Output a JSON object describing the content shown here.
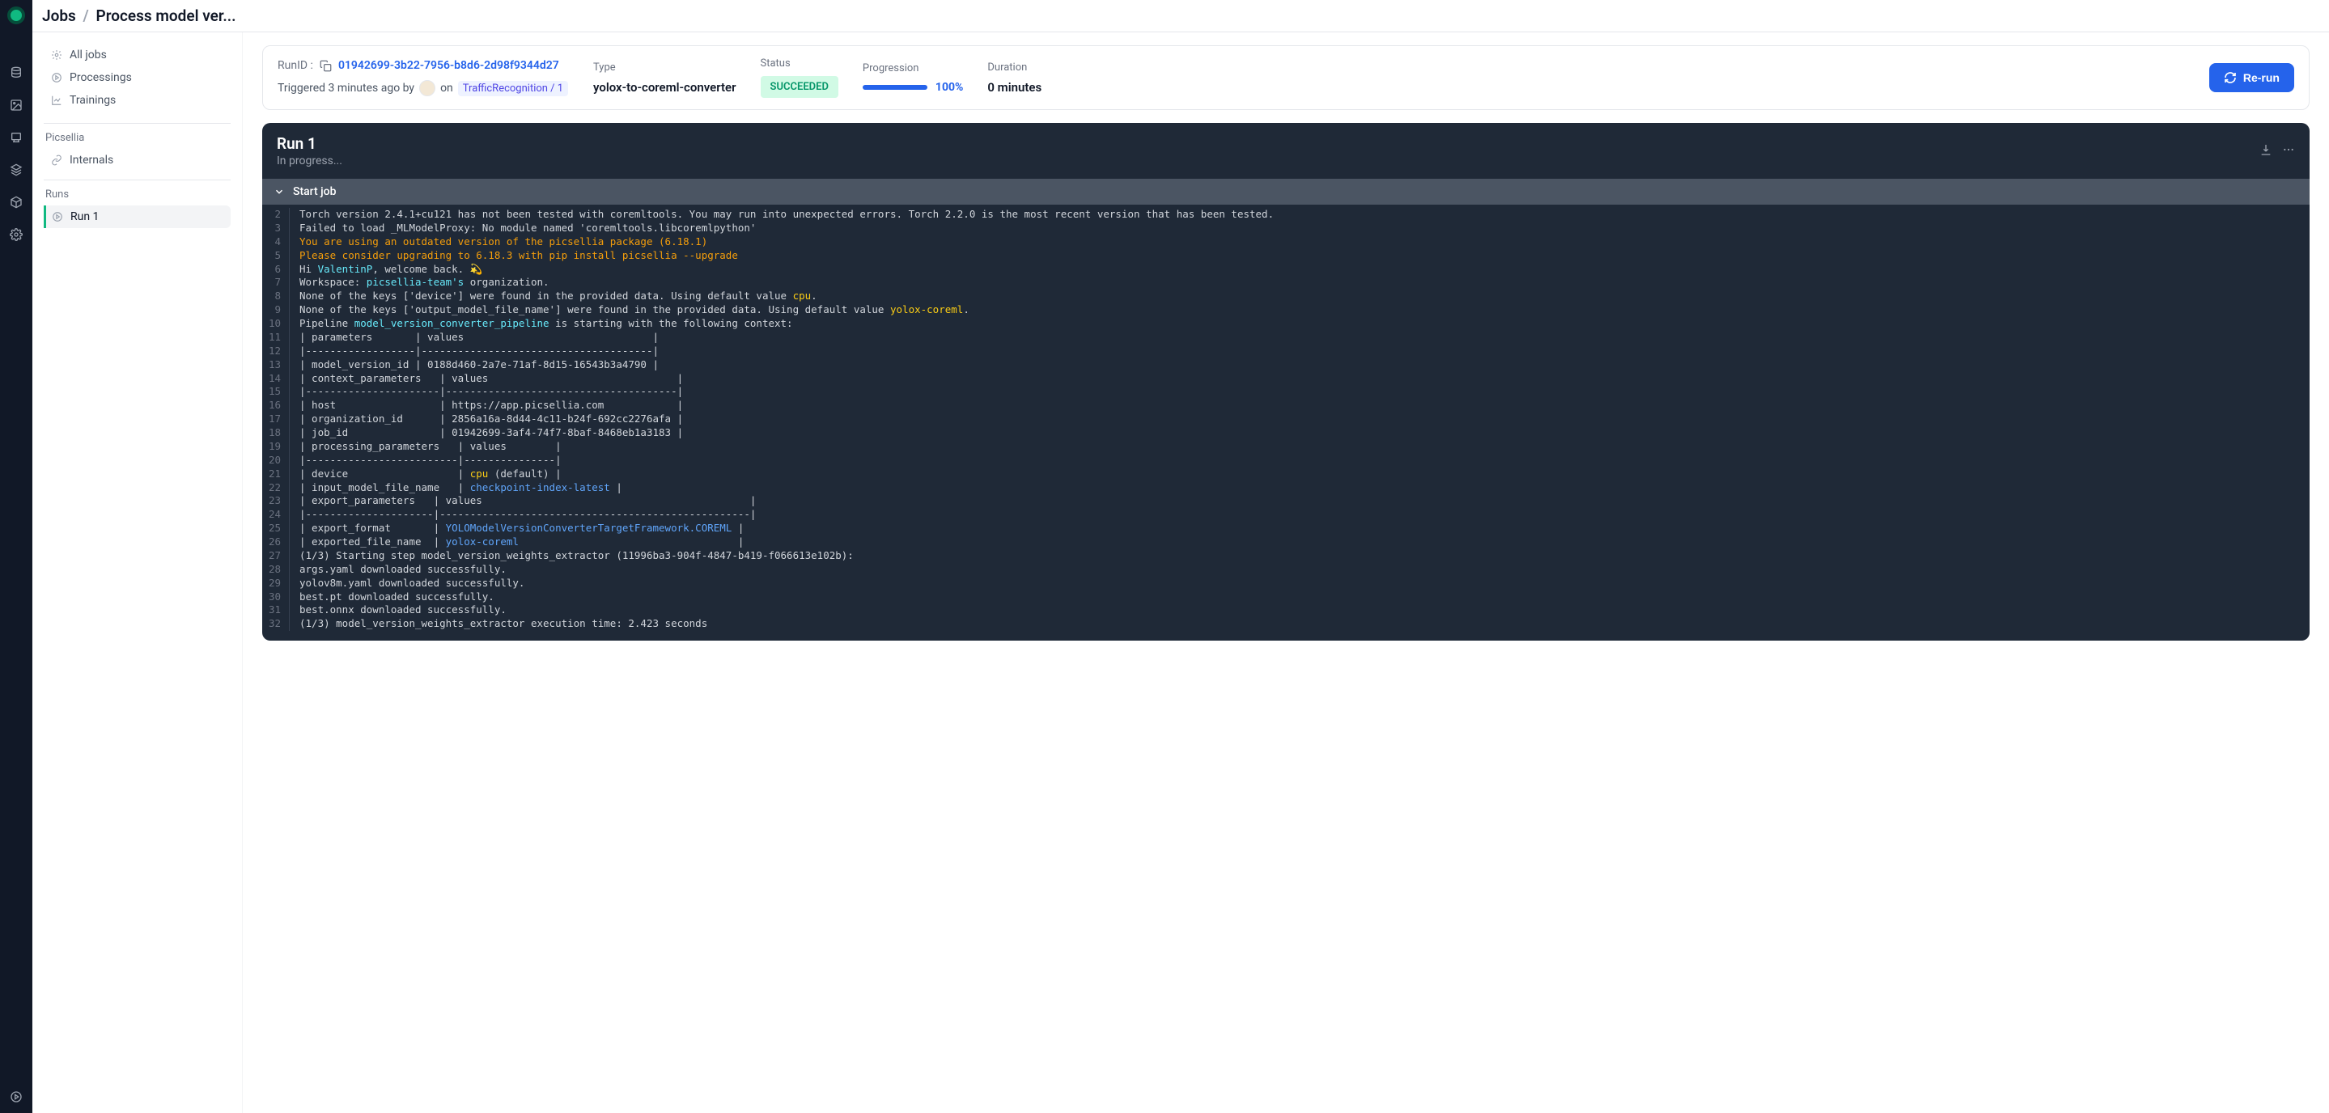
{
  "breadcrumb": {
    "root": "Jobs",
    "current": "Process model ver..."
  },
  "sidebar": {
    "items": [
      {
        "label": "All jobs"
      },
      {
        "label": "Processings"
      },
      {
        "label": "Trainings"
      }
    ],
    "heading1": "Picsellia",
    "internals_label": "Internals",
    "runs_heading": "Runs",
    "run1_label": "Run 1"
  },
  "info": {
    "runid_label": "RunID :",
    "runid_value": "01942699-3b22-7956-b8d6-2d98f9344d27",
    "triggered_prefix": "Triggered 3 minutes ago by",
    "on_word": "on",
    "model_chip": "TrafficRecognition / 1",
    "type_label": "Type",
    "type_value": "yolox-to-coreml-converter",
    "status_label": "Status",
    "status_value": "SUCCEEDED",
    "progress_label": "Progression",
    "progress_pct": "100%",
    "progress_fill": 100,
    "duration_label": "Duration",
    "duration_value": "0 minutes",
    "rerun_label": "Re-run"
  },
  "console": {
    "title": "Run 1",
    "subtitle": "In progress...",
    "section_title": "Start job"
  },
  "log": [
    {
      "n": 2,
      "segs": [
        {
          "t": "Torch version 2.4.1+cu121 has not been tested with coremltools. You may run into unexpected errors. Torch 2.2.0 is the most recent version that has been tested."
        }
      ]
    },
    {
      "n": 3,
      "segs": [
        {
          "t": "Failed to load _MLModelProxy: No module named 'coremltools.libcoremlpython'"
        }
      ]
    },
    {
      "n": 4,
      "segs": [
        {
          "t": "You are using an outdated version of the picsellia package (6.18.1)",
          "c": "c-orange"
        }
      ]
    },
    {
      "n": 5,
      "segs": [
        {
          "t": "Please consider upgrading to 6.18.3 with pip install picsellia --upgrade",
          "c": "c-orange"
        }
      ]
    },
    {
      "n": 6,
      "segs": [
        {
          "t": "Hi "
        },
        {
          "t": "ValentinP",
          "c": "c-cyan"
        },
        {
          "t": ", welcome back. 💫"
        }
      ]
    },
    {
      "n": 7,
      "segs": [
        {
          "t": "Workspace: "
        },
        {
          "t": "picsellia-team's",
          "c": "c-cyan"
        },
        {
          "t": " organization."
        }
      ]
    },
    {
      "n": 8,
      "segs": [
        {
          "t": "None of the keys ['device'] were found in the provided data. Using default value "
        },
        {
          "t": "cpu",
          "c": "c-yellow"
        },
        {
          "t": "."
        }
      ]
    },
    {
      "n": 9,
      "segs": [
        {
          "t": "None of the keys ['output_model_file_name'] were found in the provided data. Using default value "
        },
        {
          "t": "yolox-coreml",
          "c": "c-yellow"
        },
        {
          "t": "."
        }
      ]
    },
    {
      "n": 10,
      "segs": [
        {
          "t": "Pipeline "
        },
        {
          "t": "model_version_converter_pipeline",
          "c": "c-cyan"
        },
        {
          "t": " is starting with the following context:"
        }
      ]
    },
    {
      "n": 11,
      "segs": [
        {
          "t": "| parameters       | values                               |"
        }
      ]
    },
    {
      "n": 12,
      "segs": [
        {
          "t": "|------------------|--------------------------------------|"
        }
      ]
    },
    {
      "n": 13,
      "segs": [
        {
          "t": "| model_version_id | 0188d460-2a7e-71af-8d15-16543b3a4790 |"
        }
      ]
    },
    {
      "n": 14,
      "segs": [
        {
          "t": "| context_parameters   | values                               |"
        }
      ]
    },
    {
      "n": 15,
      "segs": [
        {
          "t": "|----------------------|--------------------------------------|"
        }
      ]
    },
    {
      "n": 16,
      "segs": [
        {
          "t": "| host                 | https://app.picsellia.com            |"
        }
      ]
    },
    {
      "n": 17,
      "segs": [
        {
          "t": "| organization_id      | 2856a16a-8d44-4c11-b24f-692cc2276afa |"
        }
      ]
    },
    {
      "n": 18,
      "segs": [
        {
          "t": "| job_id               | 01942699-3af4-74f7-8baf-8468eb1a3183 |"
        }
      ]
    },
    {
      "n": 19,
      "segs": [
        {
          "t": "| processing_parameters   | values        |"
        }
      ]
    },
    {
      "n": 20,
      "segs": [
        {
          "t": "|-------------------------|---------------|"
        }
      ]
    },
    {
      "n": 21,
      "segs": [
        {
          "t": "| device                  | "
        },
        {
          "t": "cpu",
          "c": "c-yellow"
        },
        {
          "t": " (default) |"
        }
      ]
    },
    {
      "n": 22,
      "segs": [
        {
          "t": "| input_model_file_name   | "
        },
        {
          "t": "checkpoint-index-latest",
          "c": "c-blue"
        },
        {
          "t": " |"
        }
      ]
    },
    {
      "n": 23,
      "segs": [
        {
          "t": "| export_parameters   | values                                            |"
        }
      ]
    },
    {
      "n": 24,
      "segs": [
        {
          "t": "|---------------------|---------------------------------------------------|"
        }
      ]
    },
    {
      "n": 25,
      "segs": [
        {
          "t": "| export_format       | "
        },
        {
          "t": "YOLOModelVersionConverterTargetFramework.COREML",
          "c": "c-blue"
        },
        {
          "t": " |"
        }
      ]
    },
    {
      "n": 26,
      "segs": [
        {
          "t": "| exported_file_name  | "
        },
        {
          "t": "yolox-coreml",
          "c": "c-blue"
        },
        {
          "t": "                                    |"
        }
      ]
    },
    {
      "n": 27,
      "segs": [
        {
          "t": "(1/3) Starting step model_version_weights_extractor (11996ba3-904f-4847-b419-f066613e102b):"
        }
      ]
    },
    {
      "n": 28,
      "segs": [
        {
          "t": "args.yaml downloaded successfully."
        }
      ]
    },
    {
      "n": 29,
      "segs": [
        {
          "t": "yolov8m.yaml downloaded successfully."
        }
      ]
    },
    {
      "n": 30,
      "segs": [
        {
          "t": "best.pt downloaded successfully."
        }
      ]
    },
    {
      "n": 31,
      "segs": [
        {
          "t": "best.onnx downloaded successfully."
        }
      ]
    },
    {
      "n": 32,
      "segs": [
        {
          "t": "(1/3) model_version_weights_extractor execution time: 2.423 seconds"
        }
      ]
    }
  ]
}
